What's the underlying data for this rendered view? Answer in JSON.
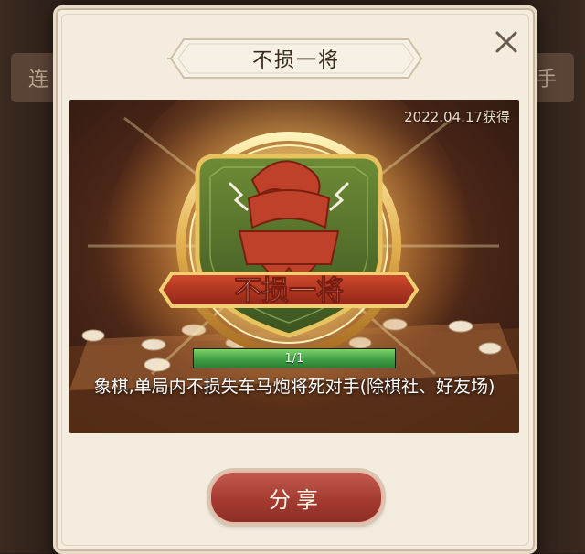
{
  "background": {
    "left_tab_text": "连",
    "right_tab_text": "手"
  },
  "dialog": {
    "title": "不损一将",
    "close_icon": "close-icon"
  },
  "achievement": {
    "date_text": "2022.04.17获得",
    "badge_text": "不损一将",
    "progress": {
      "text": "1/1",
      "current": 1,
      "total": 1,
      "fraction": 1.0
    },
    "description": "象棋,单局内不损失车马炮将死对手(除棋社、好友场)"
  },
  "actions": {
    "share_label": "分享"
  },
  "colors": {
    "panel": "#f4ecdf",
    "badge_green": "#4e6b2a",
    "badge_red": "#b03a24",
    "gold": "#e7c66a",
    "progress_green": "#3fa044",
    "share_red": "#a2392f"
  }
}
